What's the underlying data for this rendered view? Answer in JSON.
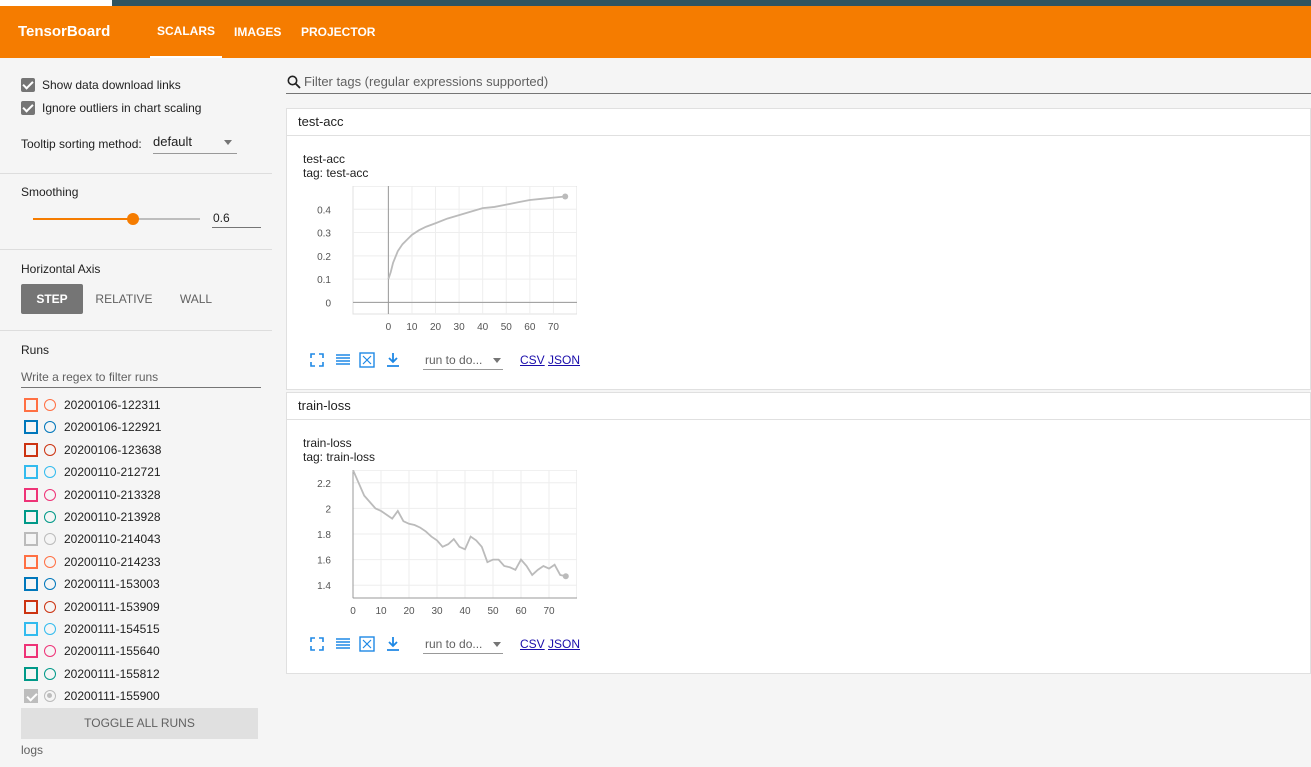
{
  "header": {
    "brand": "TensorBoard",
    "tabs": [
      {
        "label": "SCALARS",
        "active": true
      },
      {
        "label": "IMAGES",
        "active": false
      },
      {
        "label": "PROJECTOR",
        "active": false
      }
    ],
    "color": "#f57c00"
  },
  "sidebar": {
    "show_download_links": {
      "label": "Show data download links",
      "checked": true
    },
    "ignore_outliers": {
      "label": "Ignore outliers in chart scaling",
      "checked": true
    },
    "tooltip_sorting": {
      "label": "Tooltip sorting method:",
      "value": "default"
    },
    "smoothing": {
      "label": "Smoothing",
      "value": "0.6",
      "fraction": 0.6
    },
    "horizontal_axis": {
      "label": "Horizontal Axis",
      "options": [
        {
          "label": "STEP",
          "active": true
        },
        {
          "label": "RELATIVE",
          "active": false
        },
        {
          "label": "WALL",
          "active": false
        }
      ]
    },
    "runs": {
      "label": "Runs",
      "filter_placeholder": "Write a regex to filter runs",
      "items": [
        {
          "name": "20200106-122311",
          "color": "#ff7043",
          "checked": false
        },
        {
          "name": "20200106-122921",
          "color": "#0077bb",
          "checked": false
        },
        {
          "name": "20200106-123638",
          "color": "#cc3311",
          "checked": false
        },
        {
          "name": "20200110-212721",
          "color": "#33bbee",
          "checked": false
        },
        {
          "name": "20200110-213328",
          "color": "#ee3377",
          "checked": false
        },
        {
          "name": "20200110-213928",
          "color": "#009988",
          "checked": false
        },
        {
          "name": "20200110-214043",
          "color": "#bbbbbb",
          "checked": false
        },
        {
          "name": "20200110-214233",
          "color": "#ff7043",
          "checked": false
        },
        {
          "name": "20200111-153003",
          "color": "#0077bb",
          "checked": false
        },
        {
          "name": "20200111-153909",
          "color": "#cc3311",
          "checked": false
        },
        {
          "name": "20200111-154515",
          "color": "#33bbee",
          "checked": false
        },
        {
          "name": "20200111-155640",
          "color": "#ee3377",
          "checked": false
        },
        {
          "name": "20200111-155812",
          "color": "#009988",
          "checked": false
        },
        {
          "name": "20200111-155900",
          "color": "#bbbbbb",
          "checked": true
        }
      ],
      "toggle_label": "TOGGLE ALL RUNS",
      "log_dir": "logs"
    }
  },
  "main": {
    "filter_placeholder": "Filter tags (regular expressions supported)",
    "categories": [
      {
        "name": "test-acc",
        "card": {
          "title": "test-acc",
          "tag": "tag: test-acc",
          "run_select": "run to do...",
          "csv": "CSV",
          "json": "JSON"
        }
      },
      {
        "name": "train-loss",
        "card": {
          "title": "train-loss",
          "tag": "tag: train-loss",
          "run_select": "run to do...",
          "csv": "CSV",
          "json": "JSON"
        }
      }
    ]
  },
  "chart_data": [
    {
      "type": "line",
      "title": "test-acc",
      "series": [
        {
          "values_x": [
            0,
            1,
            2,
            4,
            6,
            8,
            10,
            13,
            16,
            20,
            25,
            30,
            35,
            40,
            45,
            50,
            55,
            60,
            65,
            70,
            75
          ],
          "values_y": [
            0.1,
            0.13,
            0.17,
            0.22,
            0.25,
            0.27,
            0.29,
            0.31,
            0.325,
            0.34,
            0.36,
            0.375,
            0.39,
            0.405,
            0.41,
            0.42,
            0.43,
            0.44,
            0.445,
            0.45,
            0.455
          ]
        }
      ],
      "xlim": [
        -15,
        80
      ],
      "ylim": [
        -0.05,
        0.5
      ],
      "xticks": [
        "0",
        "10",
        "20",
        "30",
        "40",
        "50",
        "60",
        "70"
      ],
      "yticks": [
        "0",
        "0.1",
        "0.2",
        "0.3",
        "0.4"
      ],
      "color": "#bbbbbb"
    },
    {
      "type": "line",
      "title": "train-loss",
      "series": [
        {
          "values_x": [
            0,
            2,
            4,
            6,
            8,
            10,
            12,
            14,
            16,
            18,
            20,
            22,
            24,
            26,
            28,
            30,
            32,
            34,
            36,
            38,
            40,
            42,
            44,
            46,
            48,
            50,
            52,
            54,
            56,
            58,
            60,
            62,
            64,
            66,
            68,
            70,
            72,
            74,
            76
          ],
          "values_y": [
            2.3,
            2.2,
            2.1,
            2.05,
            2.0,
            1.98,
            1.95,
            1.92,
            1.98,
            1.9,
            1.88,
            1.87,
            1.85,
            1.82,
            1.78,
            1.75,
            1.7,
            1.72,
            1.76,
            1.7,
            1.68,
            1.78,
            1.75,
            1.7,
            1.58,
            1.6,
            1.6,
            1.55,
            1.54,
            1.52,
            1.6,
            1.55,
            1.48,
            1.52,
            1.55,
            1.53,
            1.56,
            1.48,
            1.47
          ]
        }
      ],
      "xlim": [
        0,
        80
      ],
      "ylim": [
        1.3,
        2.3
      ],
      "xticks": [
        "0",
        "10",
        "20",
        "30",
        "40",
        "50",
        "60",
        "70"
      ],
      "yticks": [
        "1.4",
        "1.6",
        "1.8",
        "2",
        "2.2"
      ],
      "color": "#bbbbbb"
    }
  ]
}
